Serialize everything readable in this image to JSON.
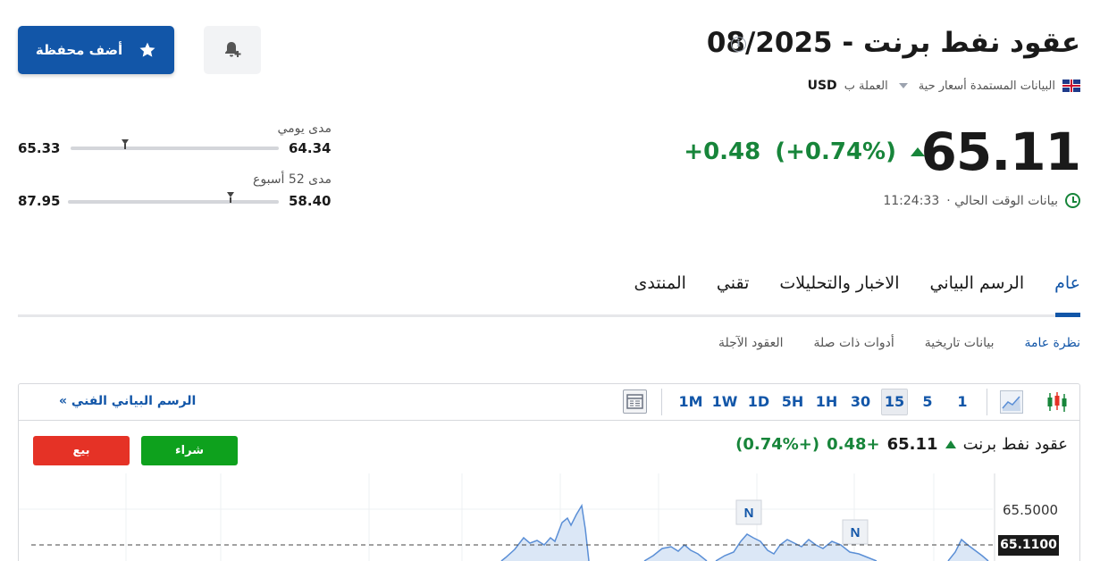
{
  "header": {
    "title": "عقود نفط برنت - 08/2025",
    "data_source": "البيانات المستمدة أسعار حية",
    "currency_label": "العملة ب",
    "currency": "USD",
    "add_portfolio_label": "أضف محفظة"
  },
  "quote": {
    "price": "65.11",
    "change": "+0.48",
    "change_pct": "(+0.74%)",
    "time_label": "بيانات الوقت الحالي ·",
    "time": "11:24:33"
  },
  "ranges": {
    "daily": {
      "label": "مدى يومي",
      "low": "64.34",
      "high": "65.33",
      "position": 0.74
    },
    "week52": {
      "label": "مدى 52 أسبوع",
      "low": "58.40",
      "high": "87.95",
      "position": 0.23
    }
  },
  "tabs": [
    {
      "label": "عام",
      "active": true
    },
    {
      "label": "الرسم البياني",
      "active": false
    },
    {
      "label": "الاخبار والتحليلات",
      "active": false
    },
    {
      "label": "تقني",
      "active": false
    },
    {
      "label": "المنتدى",
      "active": false
    }
  ],
  "subtabs": [
    {
      "label": "نظرة عامة",
      "active": true
    },
    {
      "label": "بيانات تاريخية",
      "active": false
    },
    {
      "label": "أدوات ذات صلة",
      "active": false
    },
    {
      "label": "العقود الآجلة",
      "active": false
    }
  ],
  "chart_widget": {
    "timeframes": [
      "1",
      "5",
      "15",
      "30",
      "1H",
      "5H",
      "1D",
      "1W",
      "1M"
    ],
    "active_timeframe": "15",
    "tech_chart_link": "الرسم البياني الفني »",
    "instrument_name": "عقود نفط برنت",
    "price": "65.11",
    "change": "+0.48",
    "change_pct": "(+0.74%)",
    "buy_label": "شراء",
    "sell_label": "بيع",
    "y_label_top": "65.5000",
    "y_label_current": "65.1100",
    "news_marker": "N",
    "colors": {
      "line": "#5b8fd6",
      "fill": "#dbe7f6",
      "buy": "#0ea11d",
      "sell": "#e53226",
      "accent": "#1256a8",
      "positive": "#17853a"
    }
  }
}
